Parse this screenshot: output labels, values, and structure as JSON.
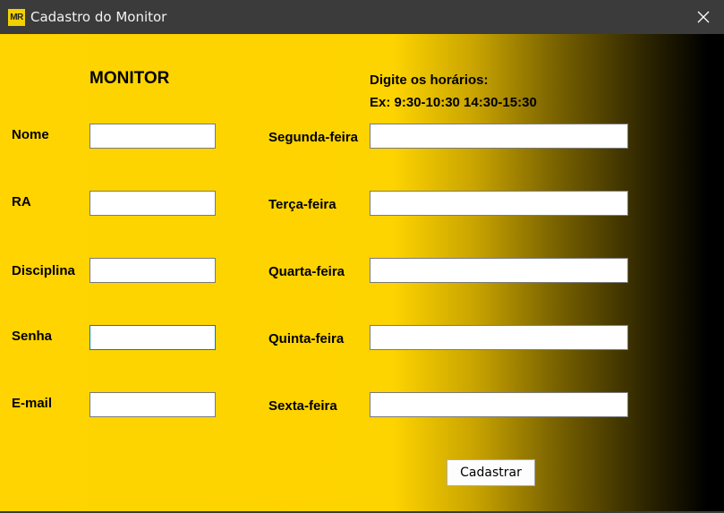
{
  "window": {
    "icon_text": "MR",
    "title": "Cadastro do Monitor",
    "close_glyph": "✕"
  },
  "form": {
    "heading": "MONITOR",
    "hint_line1": "Digite os horários:",
    "hint_line2": "Ex: 9:30-10:30 14:30-15:30",
    "left_fields": [
      {
        "label": "Nome",
        "value": ""
      },
      {
        "label": "RA",
        "value": ""
      },
      {
        "label": "Disciplina",
        "value": ""
      },
      {
        "label": "Senha",
        "value": ""
      },
      {
        "label": "E-mail",
        "value": ""
      }
    ],
    "right_fields": [
      {
        "label": "Segunda-feira",
        "value": ""
      },
      {
        "label": "Terça-feira",
        "value": ""
      },
      {
        "label": "Quarta-feira",
        "value": ""
      },
      {
        "label": "Quinta-feira",
        "value": ""
      },
      {
        "label": "Sexta-feira",
        "value": ""
      }
    ],
    "submit_label": "Cadastrar"
  },
  "colors": {
    "gradient_start": "#ffd400",
    "gradient_end": "#000000",
    "titlebar": "#3b3b3b",
    "icon_bg": "#f2d200"
  }
}
